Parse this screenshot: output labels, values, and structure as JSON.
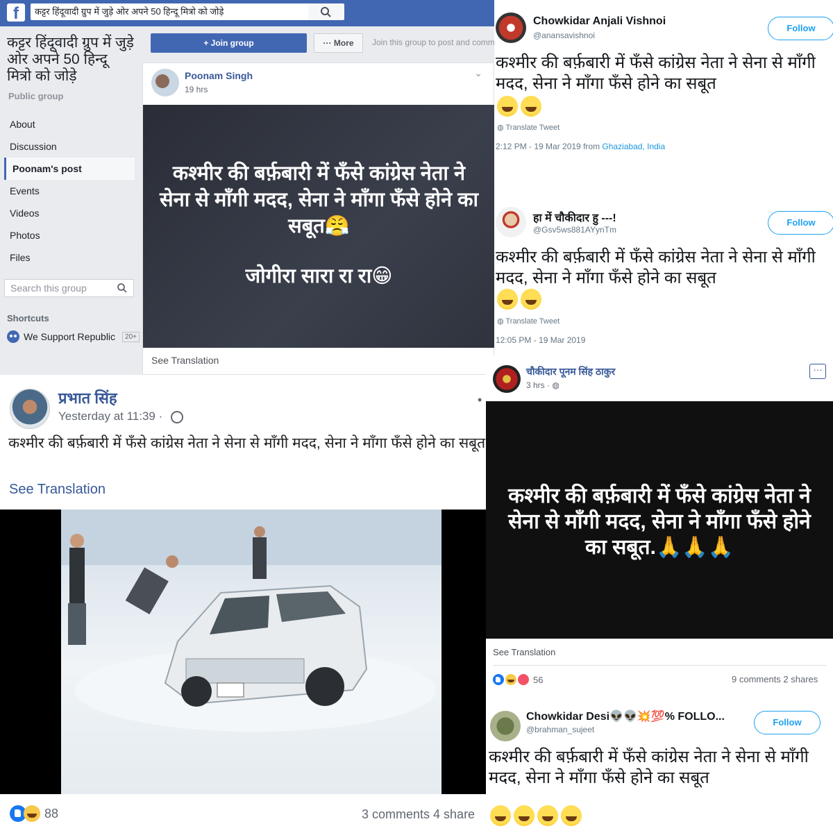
{
  "group": {
    "search_value": "कट्टर हिंदूवादी ग्रुप में जुड़े ओर अपने 50 हिन्दू मित्रो को  जोड़े",
    "title": "कट्टर हिंदूवादी ग्रुप में जुड़े ओर अपने 50 हिन्दू मित्रो को जोड़े",
    "privacy": "Public group",
    "nav": [
      "About",
      "Discussion",
      "Poonam's post",
      "Events",
      "Videos",
      "Photos",
      "Files"
    ],
    "search_placeholder": "Search this group",
    "shortcuts_label": "Shortcuts",
    "shortcut_item": "We Support Republic",
    "shortcut_badge": "20+",
    "join_button": "+ Join group",
    "more_button": "More",
    "join_hint": "Join this group to post and comm",
    "post": {
      "author": "Poonam Singh",
      "time": "19 hrs",
      "image_text": "कश्मीर की बर्फ़बारी में फँसे कांग्रेस नेता ने सेना से माँगी मदद, सेना ने माँगा फँसे होने का सबूत😤",
      "image_text_2": "जोगीरा सारा रा रा😁",
      "see_translation": "See Translation"
    }
  },
  "tweet1": {
    "name": "Chowkidar Anjali Vishnoi",
    "handle": "@anansavishnoi",
    "follow": "Follow",
    "text": "कश्मीर की बर्फ़बारी में फँसे कांग्रेस नेता ने सेना से माँगी मदद, सेना ने माँगा फँसे होने का सबूत",
    "translate": "Translate Tweet",
    "meta_time": "2:12 PM - 19 Mar 2019 from ",
    "meta_place": "Ghaziabad, India"
  },
  "tweet2": {
    "name": "हा में चौकीदार हु ---!",
    "handle": "@Gsv5ws881AYynTm",
    "follow": "Follow",
    "text": "कश्मीर की बर्फ़बारी में फँसे कांग्रेस नेता ने सेना से माँगी मदद, सेना ने माँगा फँसे होने का सबूत",
    "translate": "Translate Tweet",
    "meta_time": "12:05 PM - 19 Mar 2019"
  },
  "postD": {
    "author": "प्रभात सिंह",
    "time": "Yesterday at 11:39 ·",
    "text": "कश्मीर की बर्फ़बारी में फँसे कांग्रेस नेता ने सेना से माँगी मदद, सेना ने माँगा फँसे होने का सबूत",
    "see_translation": "See Translation",
    "reaction_count": "88",
    "counts": "3 comments  4 share"
  },
  "postE": {
    "author": "चौकीदार पूनम सिंह ठाकुर",
    "time": "3 hrs ·",
    "more": "···",
    "image_text": "कश्मीर की बर्फ़बारी में फँसे कांग्रेस नेता ने सेना से माँगी मदद, सेना ने माँगा फँसे होने का सबूत.🙏🙏🙏",
    "see_translation": "See Translation",
    "reaction_count": "56",
    "counts": "9 comments  2 shares"
  },
  "tweet3": {
    "name": "Chowkidar Desi👽👽💥💯% FOLLO...",
    "handle": "@brahman_sujeet",
    "follow": "Follow",
    "text": "कश्मीर की बर्फ़बारी में फँसे कांग्रेस नेता ने सेना से माँगी मदद, सेना ने माँगा फँसे होने का सबूत"
  },
  "colors": {
    "facebook_blue": "#4267b2",
    "link_blue": "#385898",
    "twitter_blue": "#1da1f2"
  },
  "icons": [
    "facebook-logo-icon",
    "search-icon",
    "globe-icon",
    "chevron-down-icon",
    "like-icon",
    "haha-icon",
    "love-icon",
    "more-icon"
  ]
}
